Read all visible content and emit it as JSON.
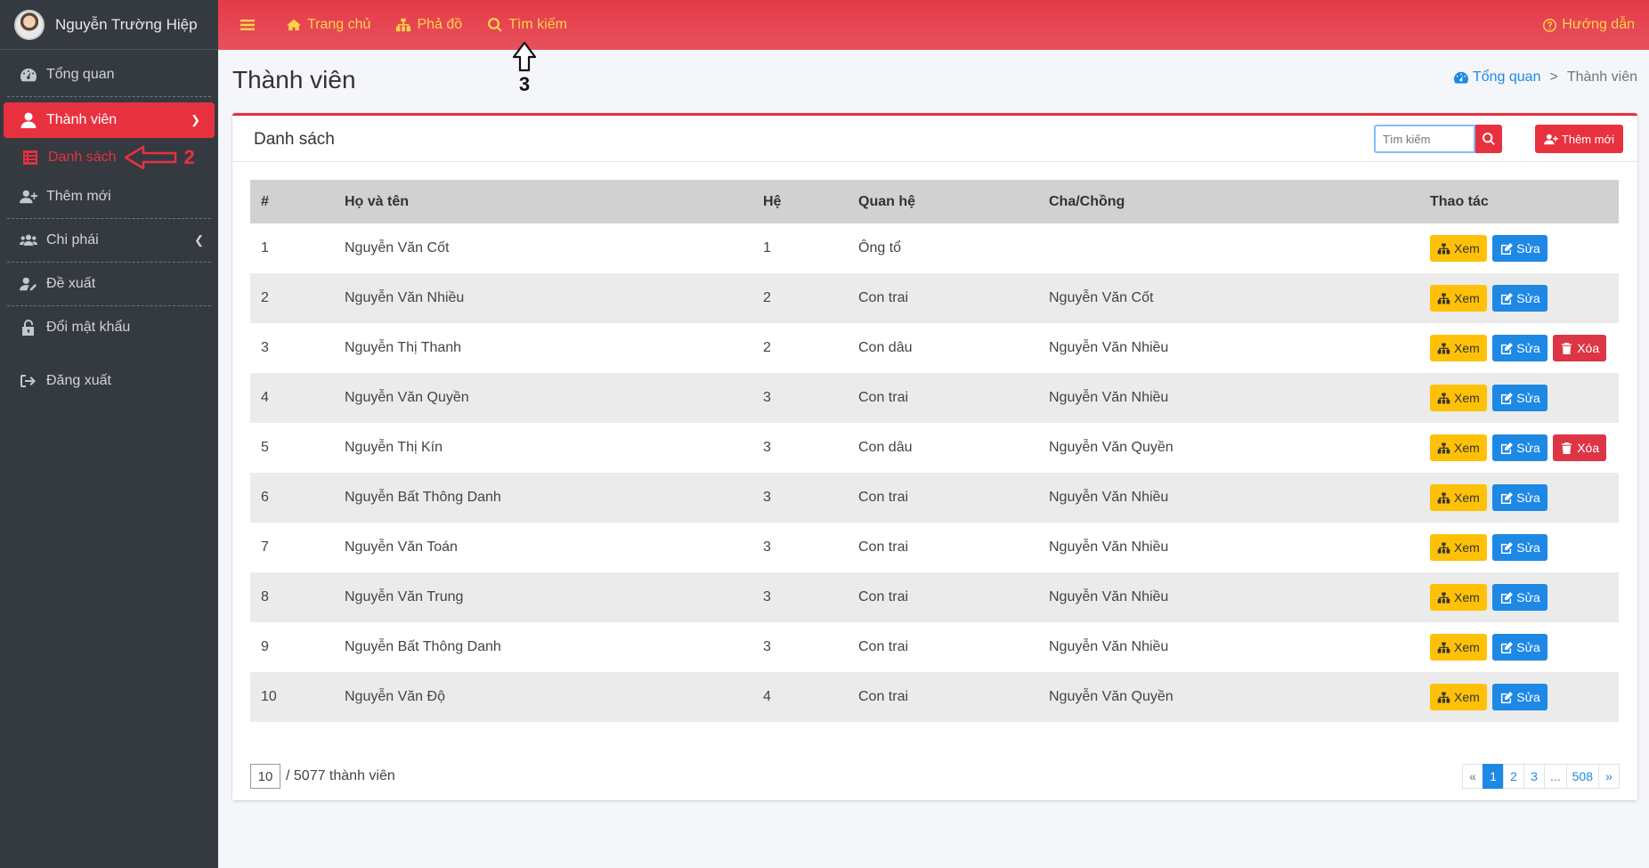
{
  "user": {
    "name": "Nguyễn Trường Hiệp"
  },
  "sidebar": {
    "items": [
      {
        "label": "Tổng quan",
        "icon": "dashboard-icon"
      },
      {
        "label": "Thành viên",
        "icon": "user-icon"
      },
      {
        "label": "Danh sách",
        "icon": "list-icon"
      },
      {
        "label": "Thêm mới",
        "icon": "user-plus-icon"
      },
      {
        "label": "Chi phái",
        "icon": "users-icon"
      },
      {
        "label": "Đề xuất",
        "icon": "user-edit-icon"
      },
      {
        "label": "Đổi mật khẩu",
        "icon": "lock-icon"
      },
      {
        "label": "Đăng xuất",
        "icon": "sign-out-icon"
      }
    ],
    "annotation": "2"
  },
  "topbar": {
    "home": "Trang chủ",
    "tree": "Phả đồ",
    "search": "Tìm kiếm",
    "help": "Hướng dẫn",
    "annotation": "3"
  },
  "page": {
    "title": "Thành viên",
    "breadcrumb": {
      "root": "Tổng quan",
      "current": "Thành viên"
    }
  },
  "card": {
    "title": "Danh sách",
    "search_placeholder": "Tìm kiếm",
    "add_label": "Thêm mới"
  },
  "table": {
    "headers": [
      "#",
      "Họ và tên",
      "Hệ",
      "Quan hệ",
      "Cha/Chồng",
      "Thao tác"
    ],
    "view_label": "Xem",
    "edit_label": "Sửa",
    "delete_label": "Xóa",
    "rows": [
      [
        "1",
        "Nguyễn Văn Cốt",
        "1",
        "Ông tổ",
        ""
      ],
      [
        "2",
        "Nguyễn Văn Nhiều",
        "2",
        "Con trai",
        "Nguyễn Văn Cốt"
      ],
      [
        "3",
        "Nguyễn Thị Thanh",
        "2",
        "Con dâu",
        "Nguyễn Văn Nhiều"
      ],
      [
        "4",
        "Nguyễn Văn Quyền",
        "3",
        "Con trai",
        "Nguyễn Văn Nhiều"
      ],
      [
        "5",
        "Nguyễn Thị Kín",
        "3",
        "Con dâu",
        "Nguyễn Văn Quyền"
      ],
      [
        "6",
        "Nguyễn Bất Thông Danh",
        "3",
        "Con trai",
        "Nguyễn Văn Nhiều"
      ],
      [
        "7",
        "Nguyễn Văn Toán",
        "3",
        "Con trai",
        "Nguyễn Văn Nhiều"
      ],
      [
        "8",
        "Nguyễn Văn Trung",
        "3",
        "Con trai",
        "Nguyễn Văn Nhiều"
      ],
      [
        "9",
        "Nguyễn Bất Thông Danh",
        "3",
        "Con trai",
        "Nguyễn Văn Nhiều"
      ],
      [
        "10",
        "Nguyễn Văn Độ",
        "4",
        "Con trai",
        "Nguyễn Văn Quyền"
      ]
    ],
    "deletable_rows": [
      3,
      5
    ]
  },
  "footer": {
    "per_page": "10",
    "total_text": "/ 5077 thành viên",
    "pages": [
      "«",
      "1",
      "2",
      "3",
      "...",
      "508",
      "»"
    ],
    "active_page": "1"
  },
  "colors": {
    "accent": "#e8313f",
    "sidebar": "#343a40",
    "link": "#1e88e5",
    "warning": "#ffc107",
    "topbar_text": "#ffd24a"
  }
}
